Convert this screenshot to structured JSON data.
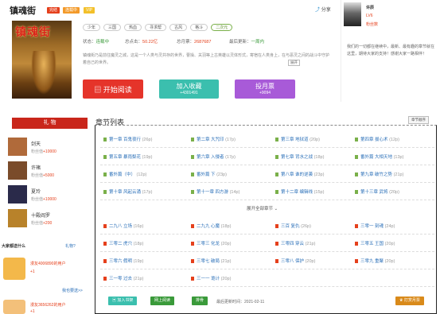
{
  "book": {
    "title": "镇魂街",
    "badges": [
      "完结",
      "连载中",
      "VIP"
    ],
    "share": "分享",
    "cover_title": "镇魂街",
    "tags": [
      "少年",
      "三国",
      "热血",
      "寻求帮",
      "古风",
      "格斗",
      "二次元"
    ],
    "author_label": "状态：",
    "author": "连载中",
    "words_label": "总点击：",
    "words": "50.22亿",
    "score_label": "总月票：",
    "score": "2687687",
    "update_label": "最后更新：",
    "update": "一周内",
    "desc": "镇魂街乃是前往魔灵之城，这是一个人类与灵共存的世界，曹操、关羽等上古英雄以灵体形式，寄宿在人类身上，在与恶灵之间的战斗中守护着自己的世界。",
    "more": "展开"
  },
  "buttons": {
    "read": "开始阅读",
    "collect": "加入收藏",
    "collect_count": "+4301491",
    "vote": "投月票",
    "vote_count": "+9094"
  },
  "sidebar": {
    "author": "许辰",
    "level": "LV6",
    "fans": "粉丝数",
    "quote": "我们的一切都在继续中，最新、最有趣的章节就在这里，期待大家的支持！感谢大家一路相伴！"
  },
  "gift": {
    "title": "礼 物",
    "items": [
      {
        "name": "剑天",
        "label": "粉丝值",
        "value": "+10000",
        "color": "#b06a3a"
      },
      {
        "name": "许褚",
        "label": "粉丝值",
        "value": "+5000",
        "color": "#7a4b2a"
      },
      {
        "name": "夏玲",
        "label": "粉丝值",
        "value": "+10000",
        "color": "#2a2a4a"
      },
      {
        "name": "十殿阎罗",
        "label": "粉丝值",
        "value": "+200",
        "color": "#b8822a"
      }
    ]
  },
  "fans": {
    "title": "大家都送什么",
    "link": "礼物?",
    "u1": "漫友4006890的用户",
    "u1v": "+1",
    "u2": "漫友3656262的用户",
    "u2v": "+1",
    "more": "我也要送>>"
  },
  "chapters": {
    "title": "章节列表",
    "sort": "章节顺序",
    "expand": "展开全部章节",
    "rows": [
      [
        {
          "t": "第一章 百鬼夜行",
          "w": "(26p)"
        },
        {
          "t": "第二章 大咒印",
          "w": "(17p)"
        },
        {
          "t": "第三章 地狱道",
          "w": "(20p)"
        },
        {
          "t": "第四章 拔心术",
          "w": "(12p)"
        }
      ],
      [
        {
          "t": "第五章 暴雨梨花",
          "w": "(19p)"
        },
        {
          "t": "第六章 入侵者",
          "w": "(17p)"
        },
        {
          "t": "第七章 背水之战",
          "w": "(18p)"
        },
        {
          "t": "番外篇 大相天地",
          "w": "(13p)"
        }
      ],
      [
        {
          "t": "番外篇（中）",
          "w": "(12p)"
        },
        {
          "t": "番外篇 下",
          "w": "(23p)"
        },
        {
          "t": "第八章 谁的逆袭",
          "w": "(23p)"
        },
        {
          "t": "第九章 破竹之势",
          "w": "(21p)"
        }
      ],
      [
        {
          "t": "第十章 风起云涌",
          "w": "(17p)"
        },
        {
          "t": "第十一章 四方游",
          "w": "(14p)"
        },
        {
          "t": "第十二章 编辑线",
          "w": "(15p)"
        },
        {
          "t": "第十三章 武将",
          "w": "(20p)"
        }
      ],
      [
        {
          "t": "二九八 立场",
          "w": "(16p)"
        },
        {
          "t": "二九九 心魔",
          "w": "(18p)"
        },
        {
          "t": "三百 复仇",
          "w": "(26p)"
        },
        {
          "t": "三零一 刻魂",
          "w": "(24p)"
        }
      ],
      [
        {
          "t": "三零二 虎穴",
          "w": "(18p)"
        },
        {
          "t": "三零三 化龙",
          "w": "(20p)"
        },
        {
          "t": "三零四 穿云",
          "w": "(21p)"
        },
        {
          "t": "三零五 王国",
          "w": "(20p)"
        }
      ],
      [
        {
          "t": "三零六 假明",
          "w": "(19p)"
        },
        {
          "t": "三零七 破局",
          "w": "(21p)"
        },
        {
          "t": "三零八 保护",
          "w": "(20p)"
        },
        {
          "t": "三零九 重聚",
          "w": "(20p)"
        }
      ],
      [
        {
          "t": "三一零 过去",
          "w": "(21p)"
        },
        {
          "t": "三一一 诡计",
          "w": "(20p)"
        }
      ]
    ]
  },
  "footer": {
    "b1": "加入书架",
    "b2": "网上阅读",
    "b3": "排骨",
    "updated": "最后更新时间：",
    "date": "2021-02-11",
    "vote": "打赏月票"
  }
}
